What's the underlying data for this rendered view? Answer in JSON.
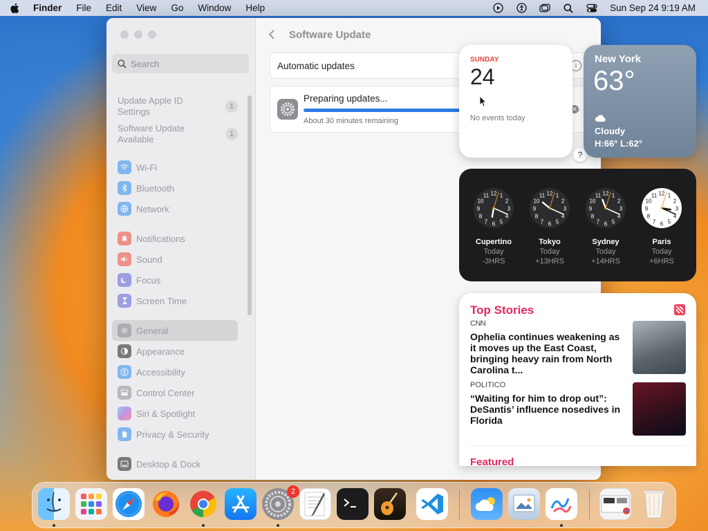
{
  "menubar": {
    "app": "Finder",
    "menus": [
      "File",
      "Edit",
      "View",
      "Go",
      "Window",
      "Help"
    ],
    "datetime": "Sun Sep 24  9:19 AM"
  },
  "settings": {
    "search_placeholder": "Search",
    "sidebar": [
      {
        "label": "Update Apple ID Settings",
        "badge": "1"
      },
      {
        "label": "Software Update Available",
        "badge": "1"
      },
      {
        "label": "Wi-Fi",
        "icon": "wifi-icon",
        "color": "#2a8cf0"
      },
      {
        "label": "Bluetooth",
        "icon": "bluetooth-icon",
        "color": "#2a8cf0"
      },
      {
        "label": "Network",
        "icon": "globe-icon",
        "color": "#2a8cf0"
      },
      {
        "label": "Notifications",
        "icon": "bell-icon",
        "color": "#f0453a"
      },
      {
        "label": "Sound",
        "icon": "speaker-icon",
        "color": "#f0453a"
      },
      {
        "label": "Focus",
        "icon": "moon-icon",
        "color": "#5b5fd6"
      },
      {
        "label": "Screen Time",
        "icon": "hourglass-icon",
        "color": "#5b5fd6"
      },
      {
        "label": "General",
        "icon": "gear-icon",
        "color": "#8e8e93"
      },
      {
        "label": "Appearance",
        "icon": "appearance-icon",
        "color": "#1c1c1e"
      },
      {
        "label": "Accessibility",
        "icon": "accessibility-icon",
        "color": "#2a8cf0"
      },
      {
        "label": "Control Center",
        "icon": "control-center-icon",
        "color": "#8e8e93"
      },
      {
        "label": "Siri & Spotlight",
        "icon": "siri-icon",
        "color": "#a24dd0"
      },
      {
        "label": "Privacy & Security",
        "icon": "hand-icon",
        "color": "#2a8cf0"
      },
      {
        "label": "Desktop & Dock",
        "icon": "dock-icon",
        "color": "#1c1c1e"
      }
    ],
    "page_title": "Software Update",
    "automatic_updates": "Automatic updates",
    "preparing": "Preparing updates...",
    "progress": 0.58,
    "remaining": "About 30 minutes remaining"
  },
  "widgets": {
    "calendar": {
      "weekday": "SUNDAY",
      "day": "24",
      "events": "No events today"
    },
    "weather": {
      "city": "New York",
      "temp": "63°",
      "condition": "Cloudy",
      "hilo": "H:66° L:62°"
    },
    "clocks": [
      {
        "city": "Cupertino",
        "day": "Today",
        "offset": "-3HRS",
        "dark": true,
        "hour": 6,
        "minute": 19
      },
      {
        "city": "Tokyo",
        "day": "Today",
        "offset": "+13HRS",
        "dark": true,
        "hour": 10,
        "minute": 19
      },
      {
        "city": "Sydney",
        "day": "Today",
        "offset": "+14HRS",
        "dark": true,
        "hour": 11,
        "minute": 19
      },
      {
        "city": "Paris",
        "day": "Today",
        "offset": "+6HRS",
        "dark": false,
        "hour": 15,
        "minute": 19
      }
    ],
    "news": {
      "section": "Top Stories",
      "stories": [
        {
          "source": "CNN",
          "headline": "Ophelia continues weakening as it moves up the East Coast, bringing heavy rain from North Carolina t..."
        },
        {
          "source": "POLITICO",
          "headline": "“Waiting for him to drop out”: DeSantis’ influence nosedives in Florida"
        }
      ],
      "featured": "Featured"
    }
  },
  "dock": {
    "settings_badge": "2",
    "apps": [
      "Finder",
      "Launchpad",
      "Safari",
      "Firefox",
      "Chrome",
      "App Store",
      "System Settings",
      "TextEdit",
      "Terminal",
      "GarageBand",
      "Visual Studio Code",
      "Weather",
      "Preview",
      "Freeform",
      "Downloads",
      "Trash"
    ]
  }
}
